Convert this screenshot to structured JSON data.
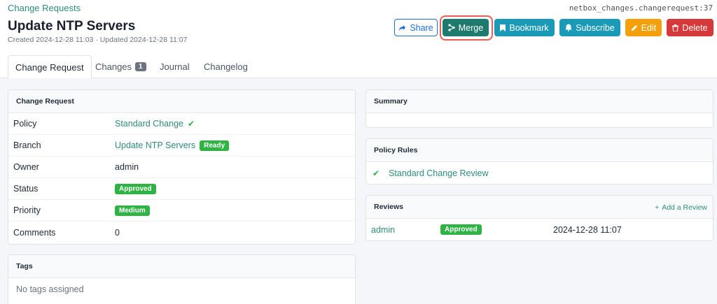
{
  "breadcrumb": "Change Requests",
  "object_ref": "netbox_changes.changerequest:37",
  "title": "Update NTP Servers",
  "meta": "Created 2024-12-28 11:03 · Updated 2024-12-28 11:07",
  "buttons": {
    "share": "Share",
    "merge": "Merge",
    "bookmark": "Bookmark",
    "subscribe": "Subscribe",
    "edit": "Edit",
    "delete": "Delete"
  },
  "tabs": [
    {
      "label": "Change Request",
      "active": true
    },
    {
      "label": "Changes",
      "badge": "1"
    },
    {
      "label": "Journal"
    },
    {
      "label": "Changelog"
    }
  ],
  "change_request_card": {
    "header": "Change Request",
    "rows": [
      {
        "label": "Policy",
        "value": "Standard Change"
      },
      {
        "label": "Branch",
        "value": "Update NTP Servers",
        "badge": "Ready"
      },
      {
        "label": "Owner",
        "value": "admin"
      },
      {
        "label": "Status",
        "badge": "Approved"
      },
      {
        "label": "Priority",
        "badge": "Medium"
      },
      {
        "label": "Comments",
        "value": "0"
      }
    ]
  },
  "tags_card": {
    "header": "Tags",
    "empty": "No tags assigned"
  },
  "summary_card": {
    "header": "Summary"
  },
  "policy_rules_card": {
    "header": "Policy Rules",
    "rule": "Standard Change Review"
  },
  "reviews_card": {
    "header": "Reviews",
    "add_label": "Add a Review",
    "review": {
      "user": "admin",
      "status": "Approved",
      "date": "2024-12-28 11:07"
    }
  },
  "colors": {
    "accent": "#2e8b7a",
    "merge": "#1f7a6e",
    "info": "#1b9ab7",
    "warning": "#f59f0b",
    "danger": "#d63939",
    "success": "#2fb344",
    "highlight": "#ef5b55"
  }
}
